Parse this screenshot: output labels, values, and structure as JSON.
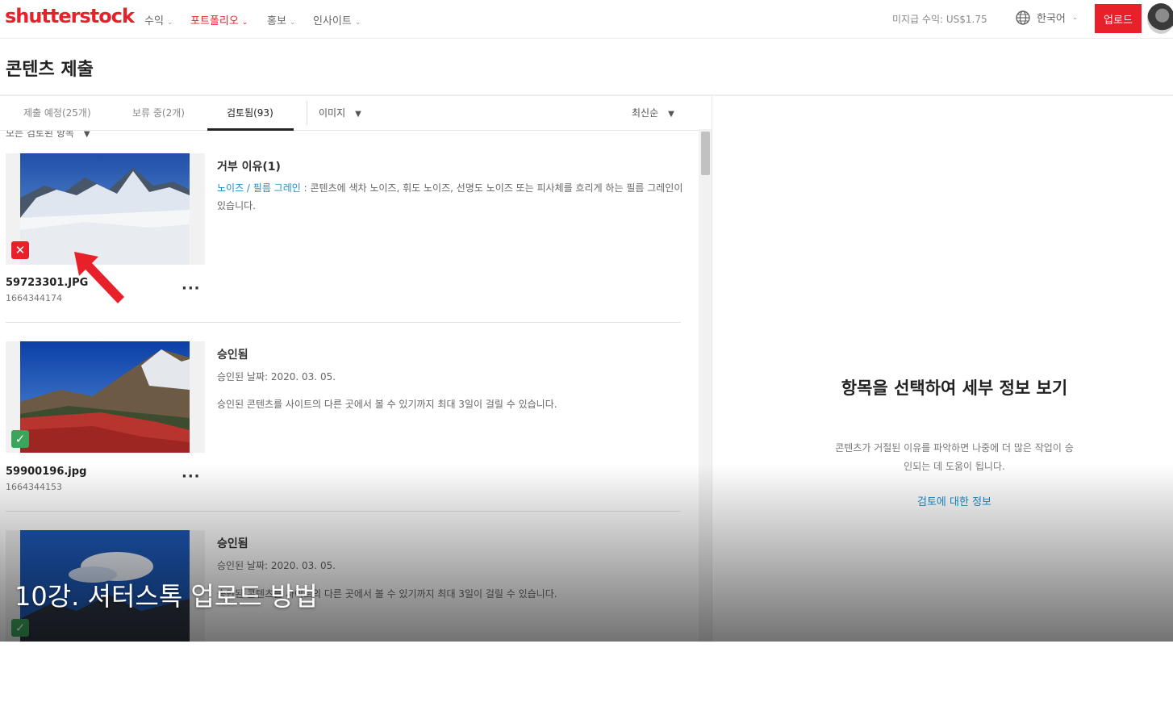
{
  "brand": {
    "logo_text": "shutterstock",
    "accent": "#e8202a"
  },
  "nav": {
    "items": [
      {
        "label": "수익"
      },
      {
        "label": "포트폴리오"
      },
      {
        "label": "홍보"
      },
      {
        "label": "인사이트"
      }
    ],
    "earnings": "미지급 수익: US$1.75",
    "language": "한국어",
    "upload_label": "업로드"
  },
  "page": {
    "title": "콘텐츠 제출"
  },
  "tabs": [
    {
      "label": "제출 예정(25개)"
    },
    {
      "label": "보류 중(2개)"
    },
    {
      "label": "검토됨(93)"
    }
  ],
  "filters": {
    "media_type": "이미지",
    "sort": "최신순",
    "scope": "모든 검토된 항목"
  },
  "items": [
    {
      "filename": "59723301.JPG",
      "id": "1664344174",
      "status": "rejected",
      "title": "거부 이유(1)",
      "reason_link": "노이즈 / 필름 그레인",
      "reason_text": " : 콘텐츠에 색차 노이즈, 휘도 노이즈, 선명도 노이즈 또는 피사체를 흐리게 하는 필름 그레인이 있습니다."
    },
    {
      "filename": "59900196.jpg",
      "id": "1664344153",
      "status": "approved",
      "title": "승인됨",
      "date_text": "승인된 날짜: 2020. 03. 05.",
      "note": "승인된 콘텐츠를 사이트의 다른 곳에서 볼 수 있기까지 최대 3일이 걸릴 수 있습니다."
    },
    {
      "status": "approved",
      "title": "승인됨",
      "date_text": "승인된 날짜: 2020. 03. 05.",
      "note": "승인된 콘텐츠를 사이트의 다른 곳에서 볼 수 있기까지 최대 3일이 걸릴 수 있습니다."
    }
  ],
  "detail": {
    "title": "항목을 선택하여 세부 정보 보기",
    "desc": "콘텐츠가 거절된 이유를 파악하면 나중에 더 많은 작업이 승인되는 데 도움이 됩니다.",
    "link": "검토에 대한 정보"
  },
  "overlay": {
    "caption": "10강. 셔터스톡 업로드 방법"
  }
}
